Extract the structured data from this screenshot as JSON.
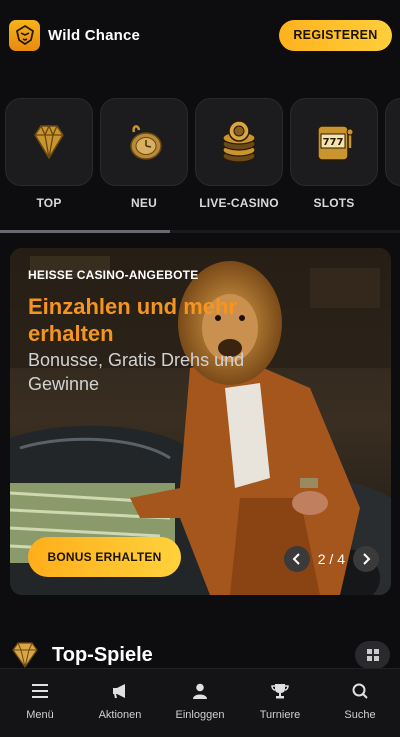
{
  "header": {
    "brand_name": "Wild Chance",
    "register_label": "REGISTEREN"
  },
  "categories": [
    {
      "label": "TOP",
      "icon": "diamond-icon"
    },
    {
      "label": "NEU",
      "icon": "pocket-watch-icon"
    },
    {
      "label": "LIVE-CASINO",
      "icon": "casino-chips-icon"
    },
    {
      "label": "SLOTS",
      "icon": "slot-machine-icon"
    }
  ],
  "hero": {
    "kicker": "HEISSE CASINO-ANGEBOTE",
    "title": "Einzahlen und mehr erhalten",
    "subtitle": "Bonusse, Gratis Drehs und Gewinne",
    "cta_label": "BONUS ERHALTEN",
    "pager": "2 / 4"
  },
  "top_games": {
    "heading": "Top-Spiele"
  },
  "bottom_nav": [
    {
      "label": "Menü",
      "icon": "menu-icon"
    },
    {
      "label": "Aktionen",
      "icon": "megaphone-icon"
    },
    {
      "label": "Einloggen",
      "icon": "user-icon"
    },
    {
      "label": "Turniere",
      "icon": "trophy-icon"
    },
    {
      "label": "Suche",
      "icon": "search-icon"
    }
  ],
  "colors": {
    "accent": "#f5951f",
    "button": "#ffbf26",
    "background": "#0d0d0f"
  }
}
